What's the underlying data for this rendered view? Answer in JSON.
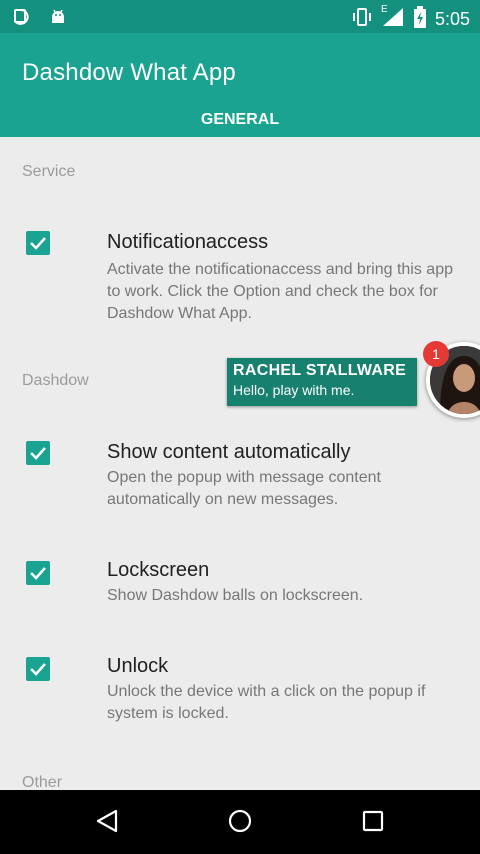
{
  "status_bar": {
    "time": "5:05",
    "network_label": "E"
  },
  "app_bar": {
    "title": "Dashdow What App",
    "tab": "GENERAL"
  },
  "sections": {
    "service": "Service",
    "dashdow": "Dashdow",
    "other": "Other"
  },
  "preferences": [
    {
      "title": "Notificationaccess",
      "summary": "Activate the notificationaccess and bring this app to work. Click the Option and check the box for Dashdow What App.",
      "checked": true
    },
    {
      "title": "Show content automatically",
      "summary": "Open the popup with message content automatically on new messages.",
      "checked": true
    },
    {
      "title": "Lockscreen",
      "summary": "Show Dashdow balls on lockscreen.",
      "checked": true
    },
    {
      "title": "Unlock",
      "summary": "Unlock the device with a click on the popup if system is locked.",
      "checked": true
    }
  ],
  "chat_head": {
    "name": "RACHEL STALLWARE",
    "message": "Hello, play with me.",
    "badge_count": "1"
  },
  "colors": {
    "status_bar": "#14907f",
    "app_bar": "#1aa390",
    "accent": "#1aa390",
    "bubble": "#17806f",
    "badge": "#e53935"
  },
  "icons": {
    "status_left": [
      "notification-icon",
      "android-debug-icon"
    ],
    "status_right": [
      "vibrate-icon",
      "signal-icon",
      "battery-charging-icon"
    ],
    "nav": [
      "back-icon",
      "home-icon",
      "recents-icon"
    ]
  }
}
